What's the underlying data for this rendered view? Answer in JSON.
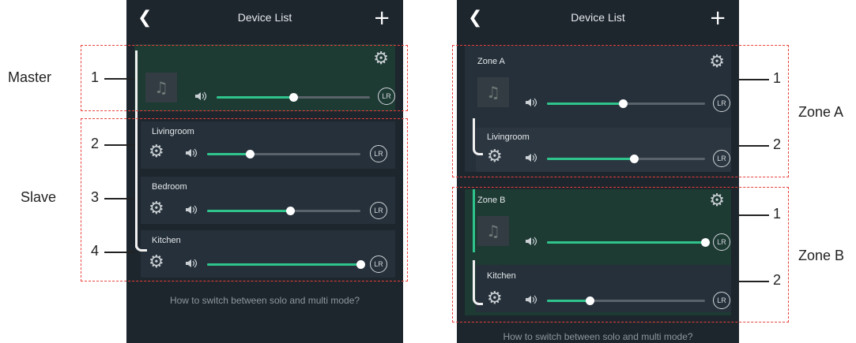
{
  "left": {
    "title": "Device List",
    "help": "How to switch between solo and multi mode?",
    "master": {
      "lr": "LR",
      "volume": 0.5
    },
    "slaves": [
      {
        "name": "Livingroom",
        "lr": "LR",
        "volume": 0.28
      },
      {
        "name": "Bedroom",
        "lr": "LR",
        "volume": 0.54
      },
      {
        "name": "Kitchen",
        "lr": "LR",
        "volume": 1.0
      }
    ]
  },
  "right": {
    "title": "Device List",
    "help": "How to switch between solo and multi mode?",
    "zones": [
      {
        "name": "Zone A",
        "lr": "LR",
        "volume": 0.48,
        "slave": {
          "name": "Livingroom",
          "lr": "LR",
          "volume": 0.55
        }
      },
      {
        "name": "Zone B",
        "lr": "LR",
        "volume": 1.0,
        "slave": {
          "name": "Kitchen",
          "lr": "LR",
          "volume": 0.27
        }
      }
    ]
  },
  "annotations": {
    "master": "Master",
    "slave": "Slave",
    "zone_a": "Zone A",
    "zone_b": "Zone B",
    "n1": "1",
    "n2": "2",
    "n3": "3",
    "n4": "4"
  },
  "icons": {
    "back": "chevron-left-icon",
    "add": "plus-icon",
    "gear": "gear-icon",
    "music": "music-note-icon",
    "volume": "speaker-icon"
  },
  "colors": {
    "accent": "#2fc48c",
    "background": "#1d252d",
    "annotation": "#e8413a"
  }
}
